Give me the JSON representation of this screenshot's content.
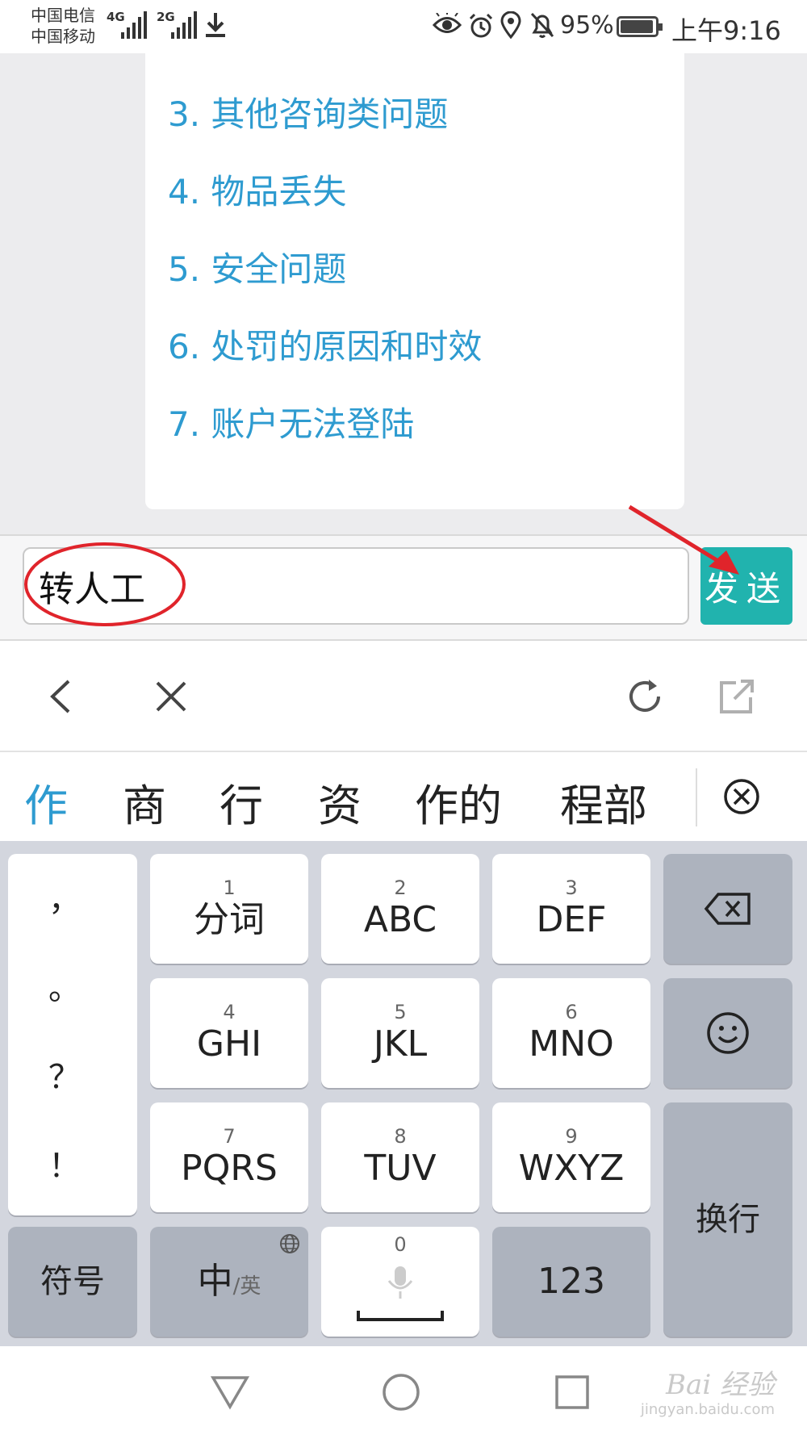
{
  "status_bar": {
    "carrier_1": "中国电信",
    "carrier_2": "中国移动",
    "net_1": "4G",
    "net_2": "2G",
    "battery_pct": "95%",
    "time": "上午9:16",
    "icons": [
      "eye-icon",
      "alarm-icon",
      "location-icon",
      "mute-bell-icon",
      "battery-icon",
      "download-icon"
    ]
  },
  "chat": {
    "options": [
      "3. 其他咨询类问题",
      "4. 物品丢失",
      "5. 安全问题",
      "6. 处罚的原因和时效",
      "7. 账户无法登陆"
    ],
    "option_color": "#2e9bd0"
  },
  "input_bar": {
    "value": "转人工",
    "send_label": "发送",
    "send_color": "#21b3ae"
  },
  "keyboard_toolbar": {
    "icons": [
      "back-icon",
      "close-icon",
      "refresh-icon",
      "share-icon"
    ]
  },
  "candidates": {
    "items": [
      "作",
      "商",
      "行",
      "资",
      "作的",
      "程部"
    ],
    "highlight_color": "#2e9bd0"
  },
  "keyboard": {
    "punctuation": [
      "，",
      "。",
      "？",
      "！"
    ],
    "keys": [
      {
        "num": "1",
        "label": "分词"
      },
      {
        "num": "2",
        "label": "ABC"
      },
      {
        "num": "3",
        "label": "DEF"
      },
      {
        "num": "4",
        "label": "GHI"
      },
      {
        "num": "5",
        "label": "JKL"
      },
      {
        "num": "6",
        "label": "MNO"
      },
      {
        "num": "7",
        "label": "PQRS"
      },
      {
        "num": "8",
        "label": "TUV"
      },
      {
        "num": "9",
        "label": "WXYZ"
      }
    ],
    "enter_label": "换行",
    "symbol_label": "符号",
    "lang_main": "中",
    "lang_sub": "/英",
    "space_num": "0",
    "num_label": "123"
  },
  "watermark": {
    "text": "Bai 经验",
    "sub": "jingyan.baidu.com"
  }
}
